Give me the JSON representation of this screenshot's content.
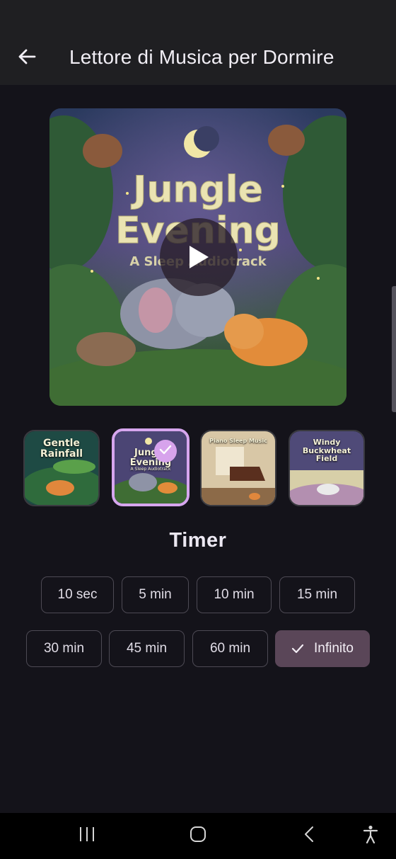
{
  "header": {
    "title": "Lettore di Musica per Dormire",
    "back_icon": "arrow-left-icon"
  },
  "player": {
    "cover_title_line1": "Jungle",
    "cover_title_line2": "Evening",
    "cover_subtitle": "A Sleep Audiotrack",
    "play_icon": "play-icon"
  },
  "tracks": [
    {
      "title_line1": "Gentle",
      "title_line2": "Rainfall",
      "selected": false
    },
    {
      "title_line1": "Jungle",
      "title_line2": "Evening",
      "subtitle": "A Sleep Audiotrack",
      "selected": true
    },
    {
      "title_line1": "Piano Sleep Music",
      "selected": false
    },
    {
      "title_line1": "Windy",
      "title_line2": "Buckwheat",
      "title_line3": "Field",
      "selected": false
    }
  ],
  "timer": {
    "title": "Timer",
    "options": [
      "10 sec",
      "5 min",
      "10 min",
      "15 min",
      "30 min",
      "45 min",
      "60 min",
      "Infinito"
    ],
    "selected": "Infinito"
  },
  "colors": {
    "background": "#14131a",
    "app_bar": "#1f1f22",
    "accent": "#d7a3ec",
    "selected_chip": "#5a4658"
  }
}
